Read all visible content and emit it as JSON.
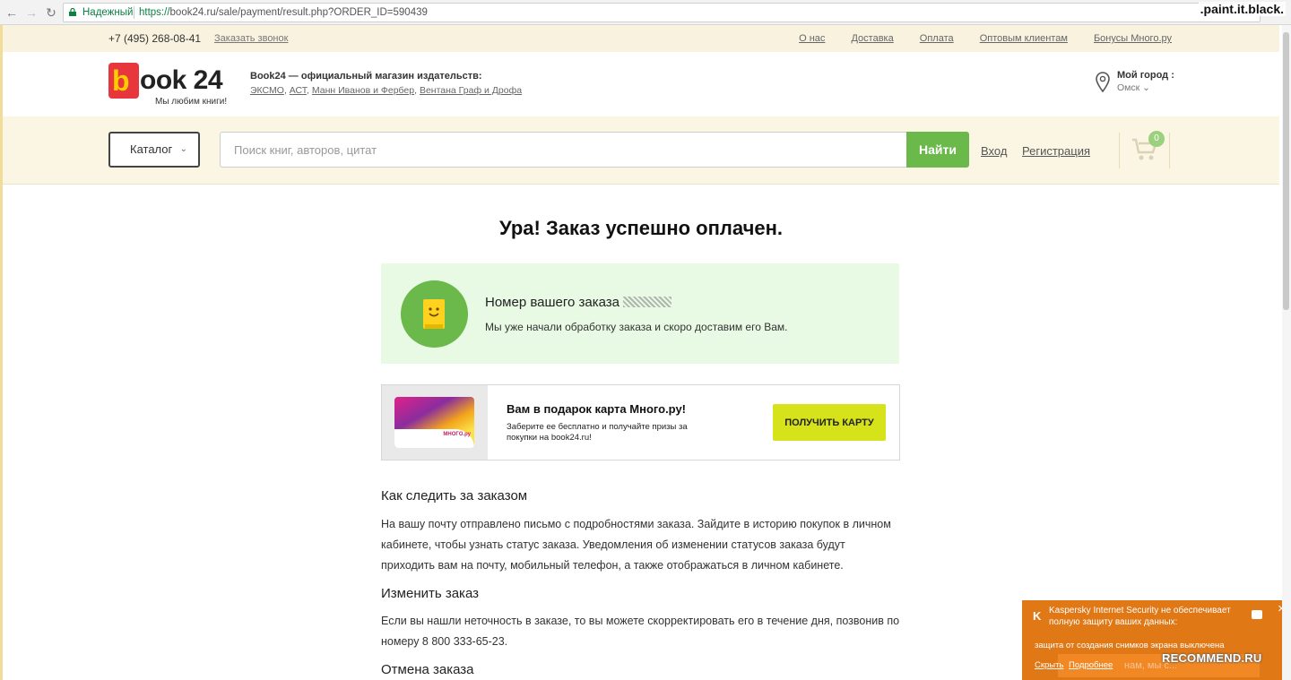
{
  "browser": {
    "secure_label": "Надежный",
    "url_protocol": "https://",
    "url_rest": "book24.ru/sale/payment/result.php?ORDER_ID=590439",
    "watermark": ".paint.it.black."
  },
  "topbar": {
    "phone": "+7 (495) 268-08-41",
    "callback": "Заказать звонок",
    "links": [
      "О нас",
      "Доставка",
      "Оплата",
      "Оптовым клиентам",
      "Бонусы Много.ру"
    ]
  },
  "header": {
    "logo_b": "b",
    "logo_rest": "ook 24",
    "slogan": "Мы любим книги!",
    "publishers_title": "Book24 — официальный магазин издательств:",
    "publishers": [
      "ЭКСМО",
      "АСТ",
      "Манн Иванов и Фербер",
      "Вентана Граф и Дрофа"
    ],
    "city_label": "Мой город :",
    "city_value": "Омск"
  },
  "search": {
    "catalog": "Каталог",
    "placeholder": "Поиск книг, авторов, цитат",
    "button": "Найти",
    "login": "Вход",
    "register": "Регистрация",
    "cart_count": "0"
  },
  "main": {
    "title": "Ура! Заказ успешно оплачен.",
    "order_title": "Номер вашего заказа",
    "order_text": "Мы уже начали обработку заказа и скоро доставим его Вам.",
    "promo_title": "Вам в подарок карта Много.ру!",
    "promo_text": "Заберите ее бесплатно и получайте призы за покупки на book24.ru!",
    "promo_button": "ПОЛУЧИТЬ КАРТУ",
    "promo_card_brand": "МНОГО.ру",
    "sections": [
      {
        "heading": "Как следить за заказом",
        "text": "На вашу почту отправлено письмо с подробностями заказа. Зайдите в историю покупок в личном кабинете, чтобы узнать статус заказа. Уведомления об изменении статусов заказа будут приходить вам на почту, мобильный телефон, а также отображаться в личном кабинете."
      },
      {
        "heading": "Изменить заказ",
        "text": "Если вы нашли неточность в заказе, то вы можете скорректировать его в течение дня, позвонив по номеру 8 800 333-65-23."
      },
      {
        "heading": "Отмена заказа",
        "text": ""
      }
    ]
  },
  "kaspersky": {
    "logo": "K",
    "title": "Kaspersky Internet Security не обеспечивает полную защиту ваших данных:",
    "body": "защита от создания снимков экрана выключена",
    "hide": "Скрыть",
    "more": "Подробнее",
    "faded": "нам, мы с..."
  },
  "watermark_bottom": "RECOMMEND.RU",
  "colors": {
    "accent_green": "#6ab94a",
    "brand_red": "#e8373c",
    "promo_yellow": "#d6e21a",
    "kaspersky_orange": "#e07816"
  }
}
